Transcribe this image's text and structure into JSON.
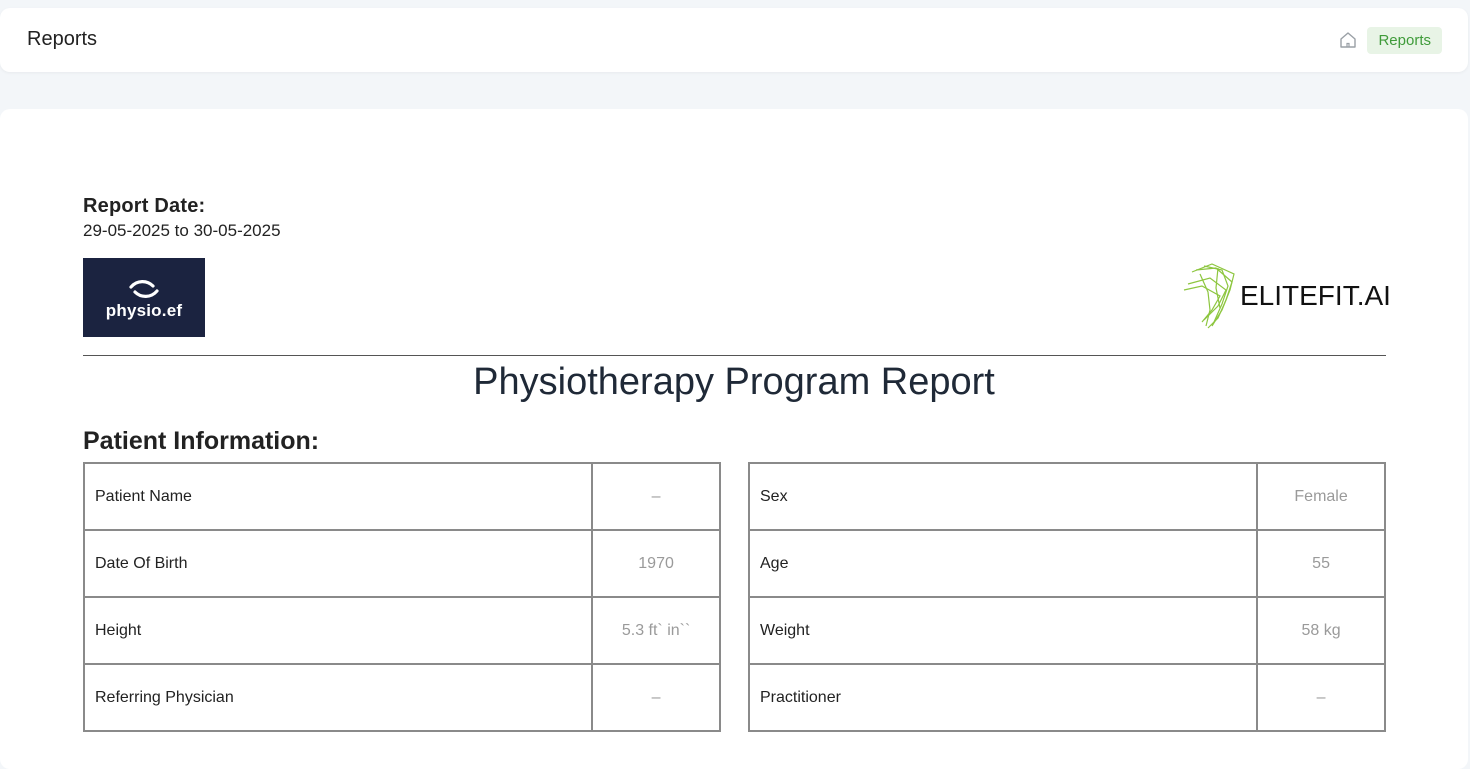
{
  "header": {
    "title": "Reports",
    "breadcrumb": "Reports"
  },
  "report": {
    "date_label": "Report Date:",
    "date_range": "29-05-2025 to 30-05-2025",
    "title": "Physiotherapy Program Report",
    "section_title": "Patient Information:"
  },
  "logos": {
    "left": "physio.ef",
    "right": "ELITEFIT.AI"
  },
  "patient": {
    "left": [
      {
        "label": "Patient Name",
        "value": "–"
      },
      {
        "label": "Date Of Birth",
        "value": "1970"
      },
      {
        "label": "Height",
        "value": "5.3 ft` in``"
      },
      {
        "label": "Referring Physician",
        "value": "–"
      }
    ],
    "right": [
      {
        "label": "Sex",
        "value": "Female"
      },
      {
        "label": "Age",
        "value": "55"
      },
      {
        "label": "Weight",
        "value": "58 kg"
      },
      {
        "label": "Practitioner",
        "value": "–"
      }
    ]
  },
  "colors": {
    "accent_green": "#3f9b3a",
    "crumb_bg": "#e8f4e6",
    "logo_bg": "#1b2340"
  },
  "icons": {
    "breadcrumb_home": "home-icon"
  }
}
